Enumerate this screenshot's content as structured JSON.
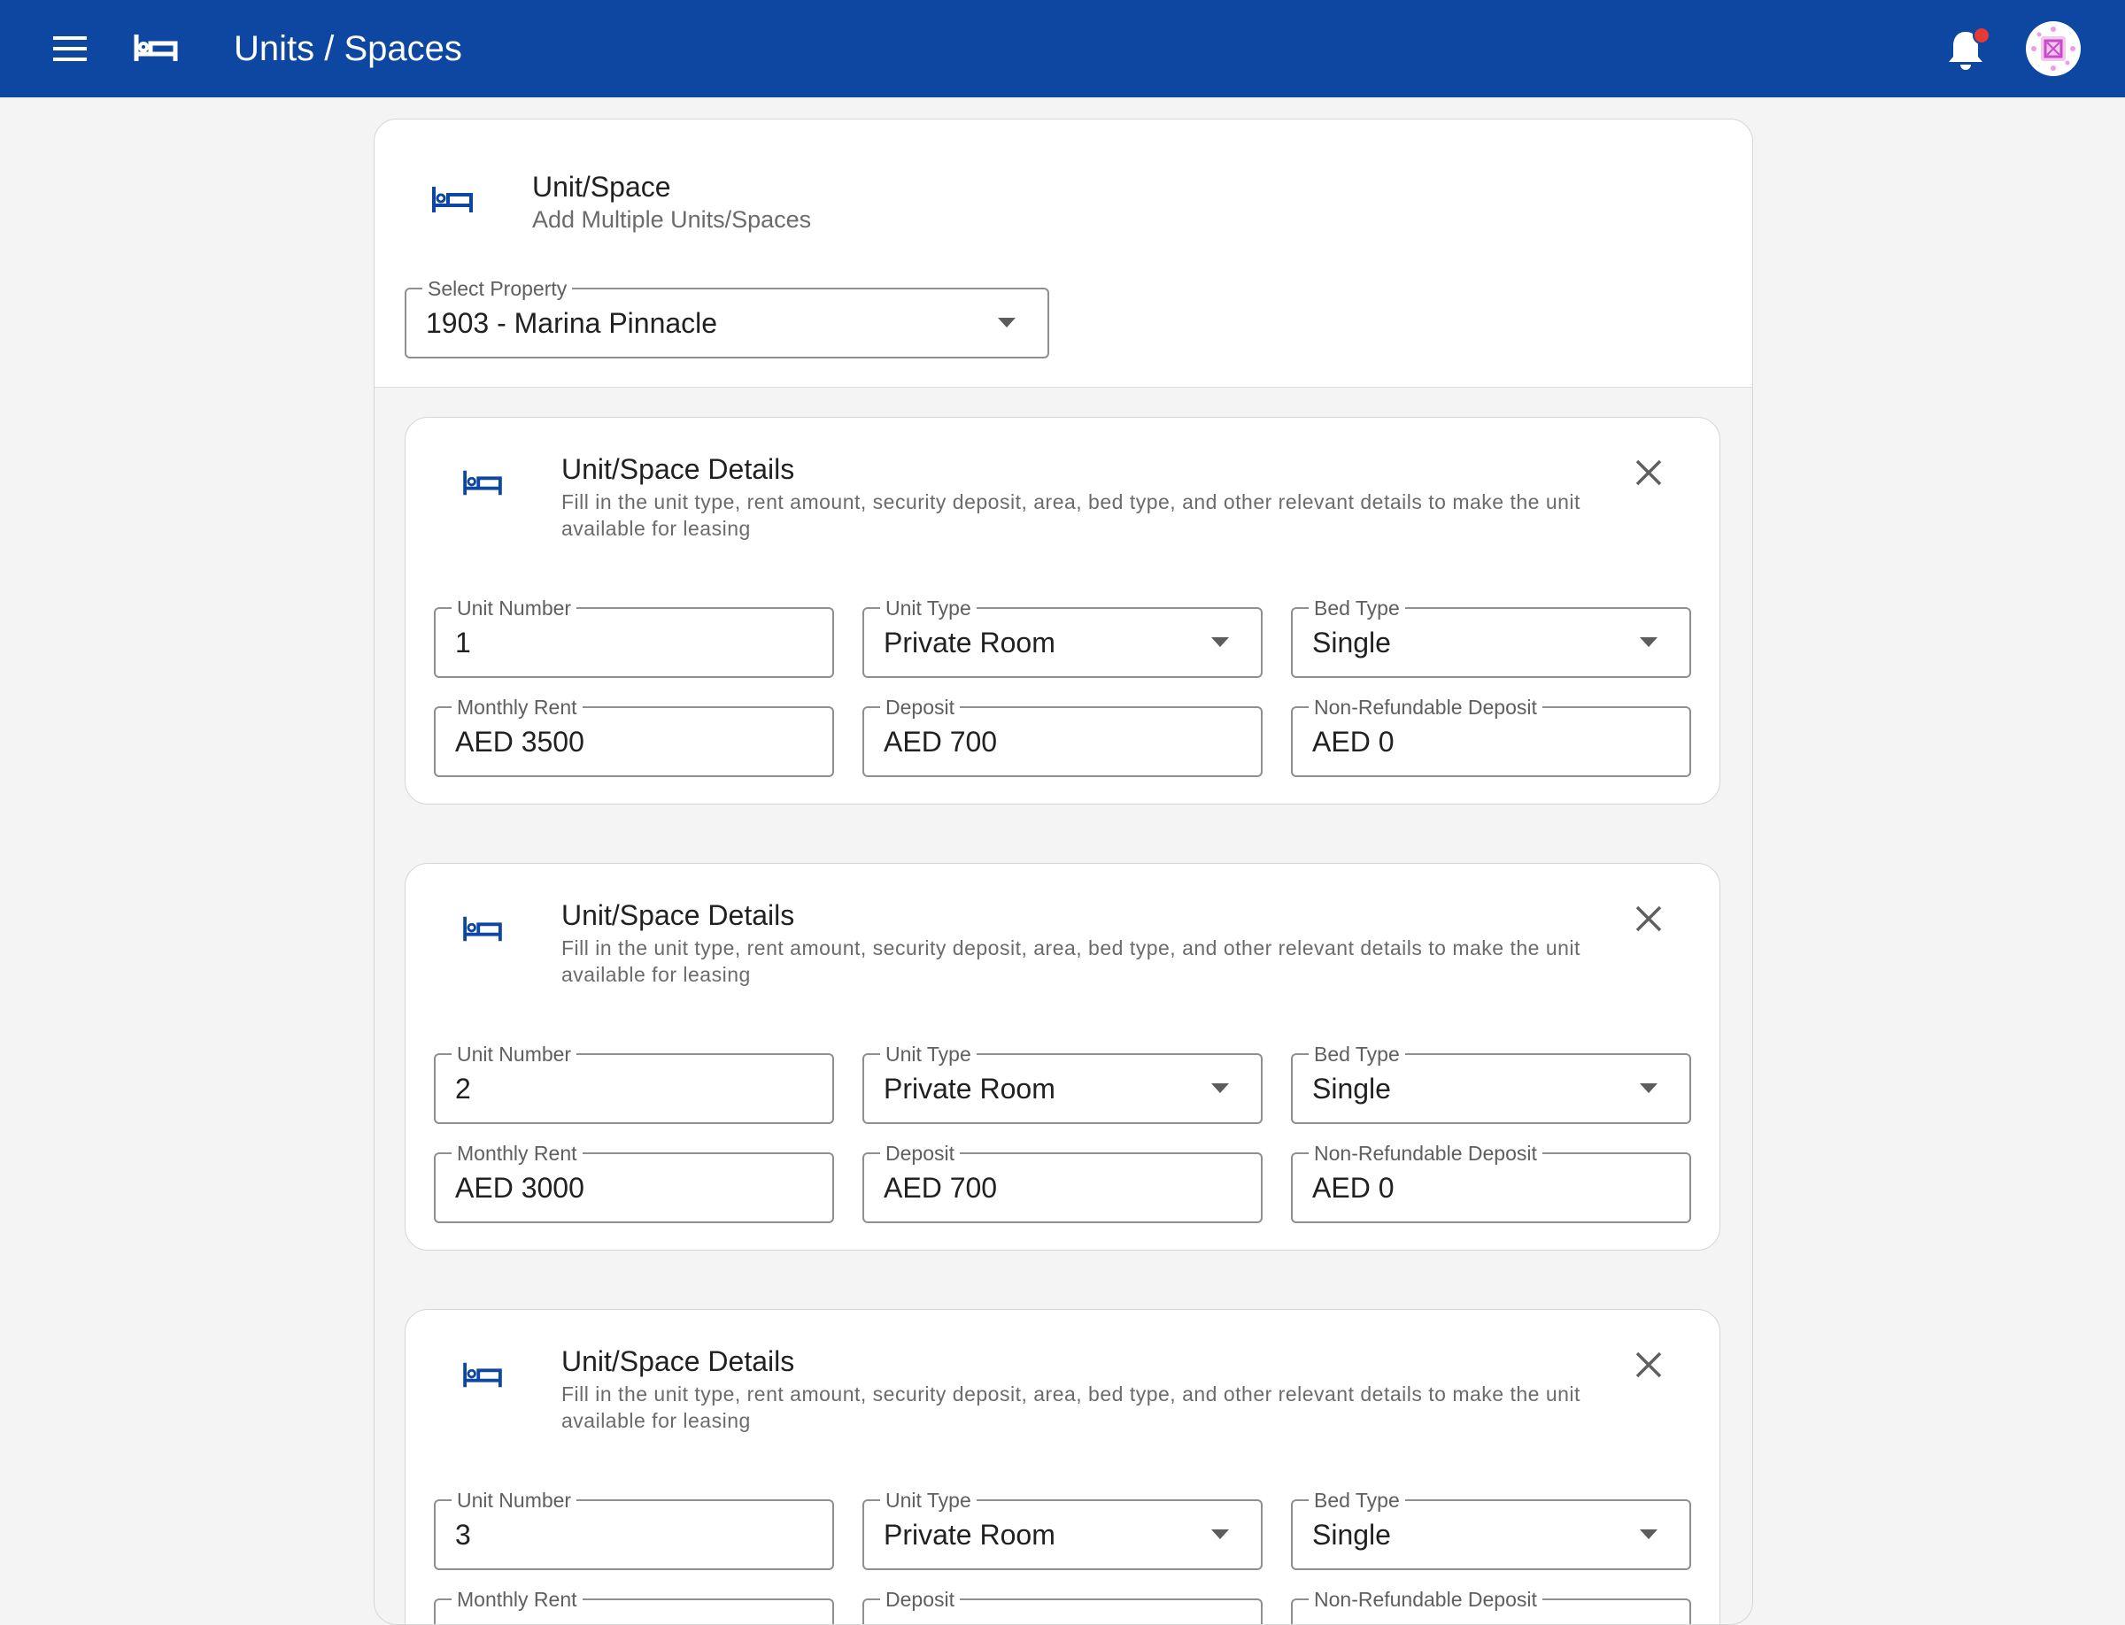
{
  "appbar": {
    "title": "Units / Spaces",
    "icons": [
      "menu-icon",
      "bed-icon",
      "bell-icon",
      "avatar"
    ],
    "color": "#0d47a1",
    "notification_dot_color": "#e53935"
  },
  "header": {
    "title": "Unit/Space",
    "subtitle": "Add Multiple Units/Spaces",
    "select_property": {
      "label": "Select Property",
      "value": "1903 - Marina Pinnacle"
    }
  },
  "units": [
    {
      "title": "Unit/Space Details",
      "description": "Fill in the unit type, rent amount, security deposit, area, bed type, and other relevant details to make the unit available for leasing",
      "unit_number": {
        "label": "Unit Number",
        "value": "1"
      },
      "unit_type": {
        "label": "Unit Type",
        "value": "Private Room"
      },
      "bed_type": {
        "label": "Bed Type",
        "value": "Single"
      },
      "monthly_rent": {
        "label": "Monthly Rent",
        "value": "AED 3500"
      },
      "deposit": {
        "label": "Deposit",
        "value": "AED 700"
      },
      "non_refundable_deposit": {
        "label": "Non-Refundable Deposit",
        "value": "AED 0"
      }
    },
    {
      "title": "Unit/Space Details",
      "description": "Fill in the unit type, rent amount, security deposit, area, bed type, and other relevant details to make the unit available for leasing",
      "unit_number": {
        "label": "Unit Number",
        "value": "2"
      },
      "unit_type": {
        "label": "Unit Type",
        "value": "Private Room"
      },
      "bed_type": {
        "label": "Bed Type",
        "value": "Single"
      },
      "monthly_rent": {
        "label": "Monthly Rent",
        "value": "AED 3000"
      },
      "deposit": {
        "label": "Deposit",
        "value": "AED 700"
      },
      "non_refundable_deposit": {
        "label": "Non-Refundable Deposit",
        "value": "AED 0"
      }
    },
    {
      "title": "Unit/Space Details",
      "description": "Fill in the unit type, rent amount, security deposit, area, bed type, and other relevant details to make the unit available for leasing",
      "unit_number": {
        "label": "Unit Number",
        "value": "3"
      },
      "unit_type": {
        "label": "Unit Type",
        "value": "Private Room"
      },
      "bed_type": {
        "label": "Bed Type",
        "value": "Single"
      },
      "monthly_rent": {
        "label": "Monthly Rent",
        "value": ""
      },
      "deposit": {
        "label": "Deposit",
        "value": ""
      },
      "non_refundable_deposit": {
        "label": "Non-Refundable Deposit",
        "value": ""
      }
    }
  ]
}
